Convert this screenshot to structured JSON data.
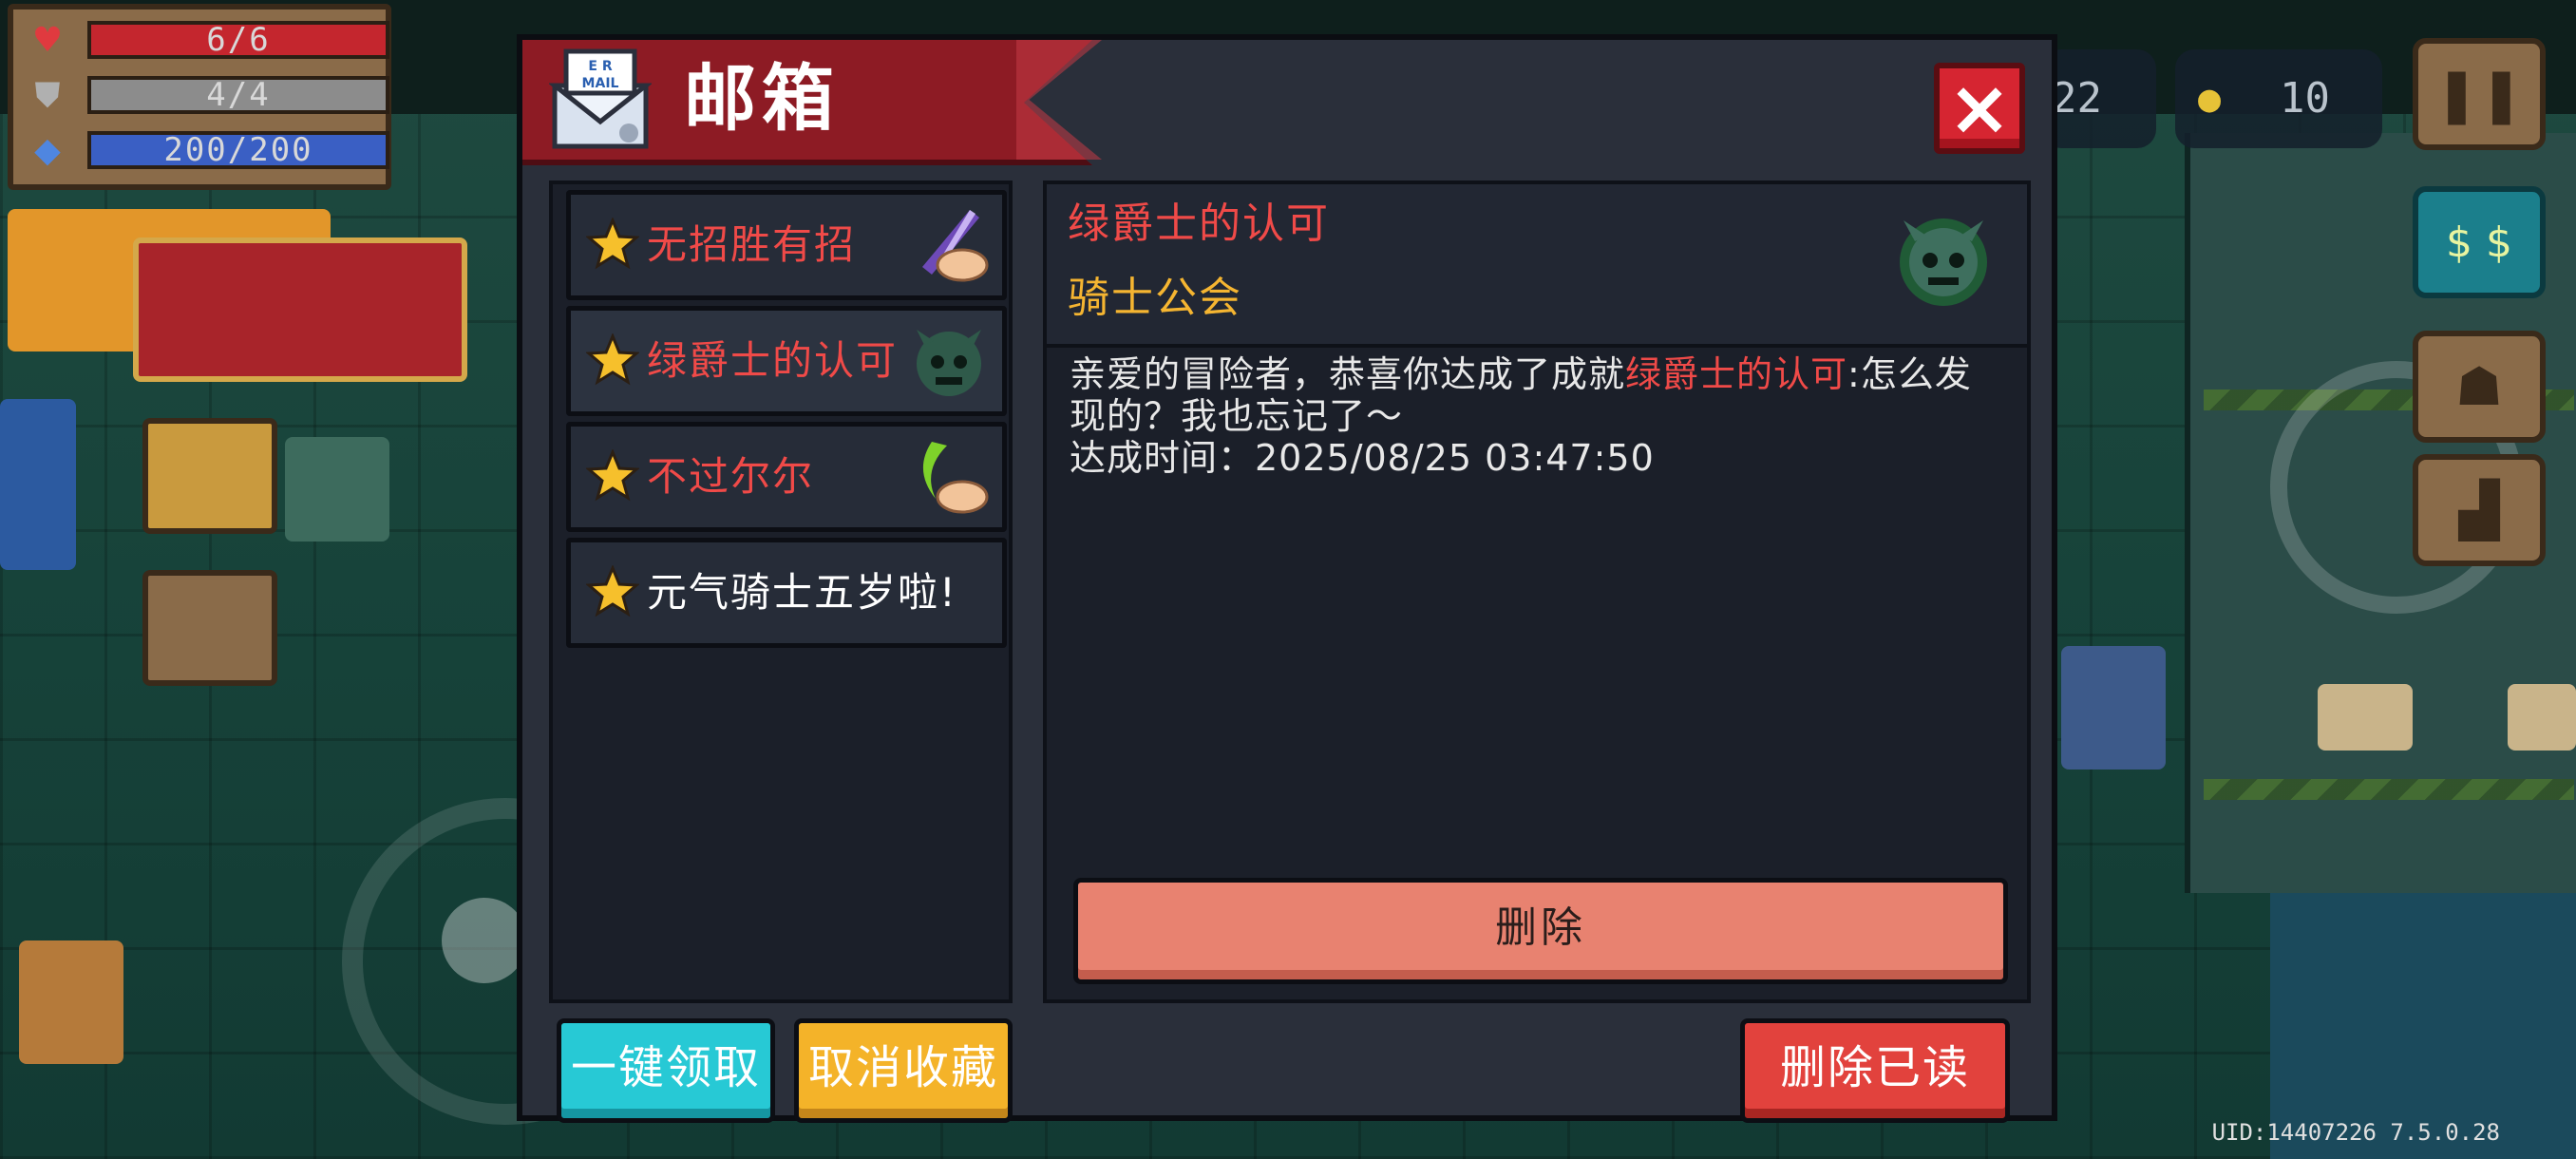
{
  "status": {
    "hp": {
      "text": "6/6",
      "fraction": 1.0,
      "color": "#c4262e"
    },
    "armor": {
      "text": "4/4",
      "fraction": 1.0,
      "color": "#8c8c8c"
    },
    "energy": {
      "text": "200/200",
      "fraction": 1.0,
      "color": "#3a5fc4"
    }
  },
  "hud": {
    "gems": "22",
    "coins": "10"
  },
  "dialog": {
    "title": "邮箱",
    "mail_icon_text": "E R MAIL",
    "close_label": "×",
    "mails": [
      {
        "title": "无招胜有招",
        "color": "#f04a48",
        "thumb": "sword-hand-icon"
      },
      {
        "title": "绿爵士的认可",
        "color": "#f04a48",
        "thumb": "green-skull-icon",
        "selected": true
      },
      {
        "title": "不过尔尔",
        "color": "#f04a48",
        "thumb": "green-blade-hand-icon"
      },
      {
        "title": "元气骑士五岁啦!",
        "color": "#ffffff",
        "thumb": ""
      }
    ],
    "detail": {
      "subject": "绿爵士的认可",
      "sender": "骑士公会",
      "body_prefix": "亲爱的冒险者，恭喜你达成了成就",
      "body_highlight": "绿爵士的认可",
      "body_suffix": ":怎么发现的？我也忘记了～",
      "time_line": "达成时间：2025/08/25 03:47:50",
      "delete_label": "删除"
    },
    "buttons": {
      "claim_all": "一键领取",
      "unfavorite": "取消收藏",
      "delete_read": "删除已读"
    }
  },
  "footer": {
    "uid": "UID:14407226 7.5.0.28"
  },
  "colors": {
    "accent_red": "#f04a48",
    "accent_orange": "#f5b531",
    "panel": "#1b1f29"
  }
}
